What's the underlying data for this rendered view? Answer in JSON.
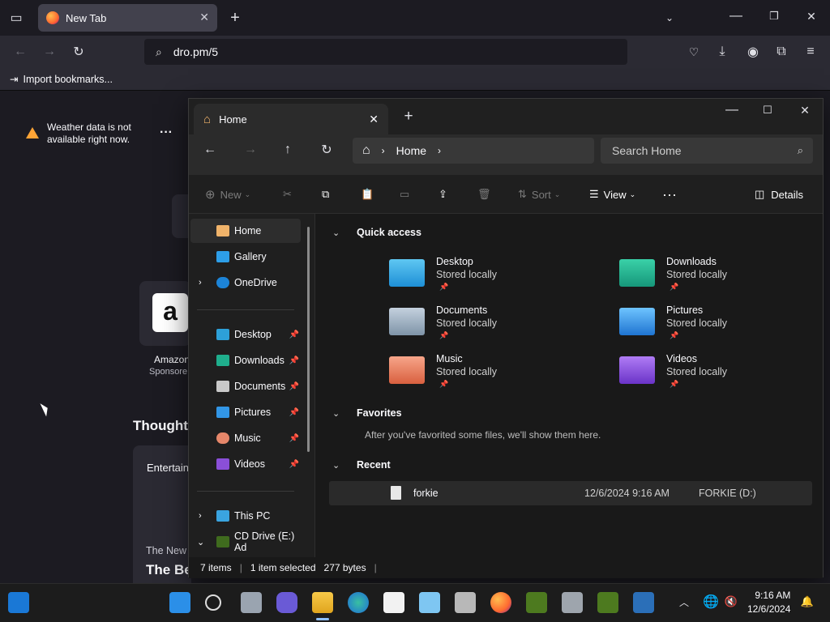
{
  "browser": {
    "tab_title": "New Tab",
    "url": "dro.pm/5",
    "bookmark_item": "Import bookmarks...",
    "weather_msg_line1": "Weather data is not",
    "weather_msg_line2": "available right now.",
    "shortcut_name": "Amazon",
    "shortcut_sub": "Sponsore",
    "thought_heading": "Thought-",
    "card_tag": "Entertain",
    "card_source": "The New",
    "card_title": "The Be"
  },
  "explorer": {
    "tab_title": "Home",
    "breadcrumb": "Home",
    "search_placeholder": "Search Home",
    "toolbar": {
      "new": "New",
      "sort": "Sort",
      "view": "View",
      "details": "Details"
    },
    "nav": {
      "home": "Home",
      "gallery": "Gallery",
      "onedrive": "OneDrive",
      "desktop": "Desktop",
      "downloads": "Downloads",
      "documents": "Documents",
      "pictures": "Pictures",
      "music": "Music",
      "videos": "Videos",
      "thispc": "This PC",
      "cddrive": "CD Drive (E:) Ad"
    },
    "quick_access_title": "Quick access",
    "quick_access": [
      {
        "name": "Desktop",
        "status": "Stored locally"
      },
      {
        "name": "Downloads",
        "status": "Stored locally"
      },
      {
        "name": "Documents",
        "status": "Stored locally"
      },
      {
        "name": "Pictures",
        "status": "Stored locally"
      },
      {
        "name": "Music",
        "status": "Stored locally"
      },
      {
        "name": "Videos",
        "status": "Stored locally"
      }
    ],
    "favorites_title": "Favorites",
    "favorites_empty": "After you've favorited some files, we'll show them here.",
    "recent_title": "Recent",
    "recent": [
      {
        "name": "forkie",
        "date": "12/6/2024 9:16 AM",
        "location": "FORKIE (D:)"
      }
    ],
    "status": {
      "items": "7 items",
      "selected": "1 item selected",
      "size": "277 bytes"
    }
  },
  "taskbar": {
    "time": "9:16 AM",
    "date": "12/6/2024"
  }
}
